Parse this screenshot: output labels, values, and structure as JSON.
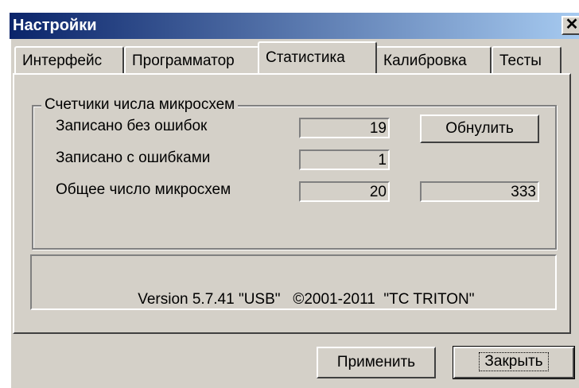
{
  "window": {
    "title": "Настройки",
    "close_glyph": "✕"
  },
  "tabs": [
    {
      "label": "Интерфейс",
      "active": false
    },
    {
      "label": "Программатор",
      "active": false
    },
    {
      "label": "Статистика",
      "active": true
    },
    {
      "label": "Калибровка",
      "active": false
    },
    {
      "label": "Тесты",
      "active": false
    }
  ],
  "stats": {
    "group_title": "Счетчики числа микросхем",
    "rows": [
      {
        "label": "Записано без ошибок",
        "value": "19"
      },
      {
        "label": "Записано с ошибками",
        "value": "1"
      },
      {
        "label": "Общее число микросхем",
        "value": "20"
      }
    ],
    "extra_value": "333",
    "reset_label": "Обнулить"
  },
  "version_text": "Version 5.7.41 \"USB\"   ©2001-2011  \"TC TRITON\"",
  "footer": {
    "apply_label": "Применить",
    "close_label": "Закрыть"
  },
  "colors": {
    "face": "#d4d0c8",
    "title_start": "#0a246a",
    "title_end": "#a6caf0"
  }
}
